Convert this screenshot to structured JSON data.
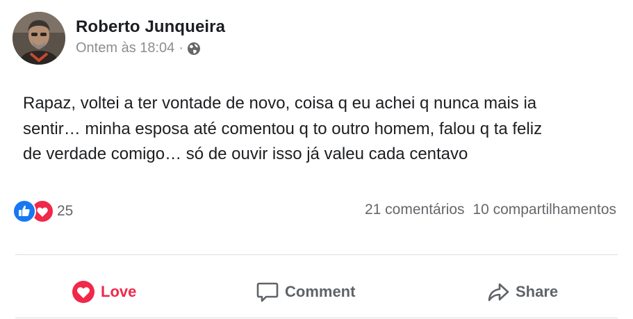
{
  "post": {
    "author": "Roberto Junqueira",
    "timestamp": "Ontem às 18:04",
    "separator": "·",
    "privacy_icon": "globe-icon",
    "text": "Rapaz, voltei a ter vontade de novo, coisa q eu achei q nunca mais ia\nsentir… minha esposa até comentou q to outro homem, falou q ta feliz\nde verdade comigo… só de ouvir isso já valeu cada centavo"
  },
  "reactions": {
    "icons": [
      "like-icon",
      "love-icon"
    ],
    "count": "25",
    "comments": "21 comentários",
    "shares": "10 compartilhamentos"
  },
  "actions": {
    "love_label": "Love",
    "comment_label": "Comment",
    "share_label": "Share"
  },
  "colors": {
    "like_blue": "#1877f2",
    "love_red": "#f0284a",
    "muted_text": "#65676b"
  }
}
